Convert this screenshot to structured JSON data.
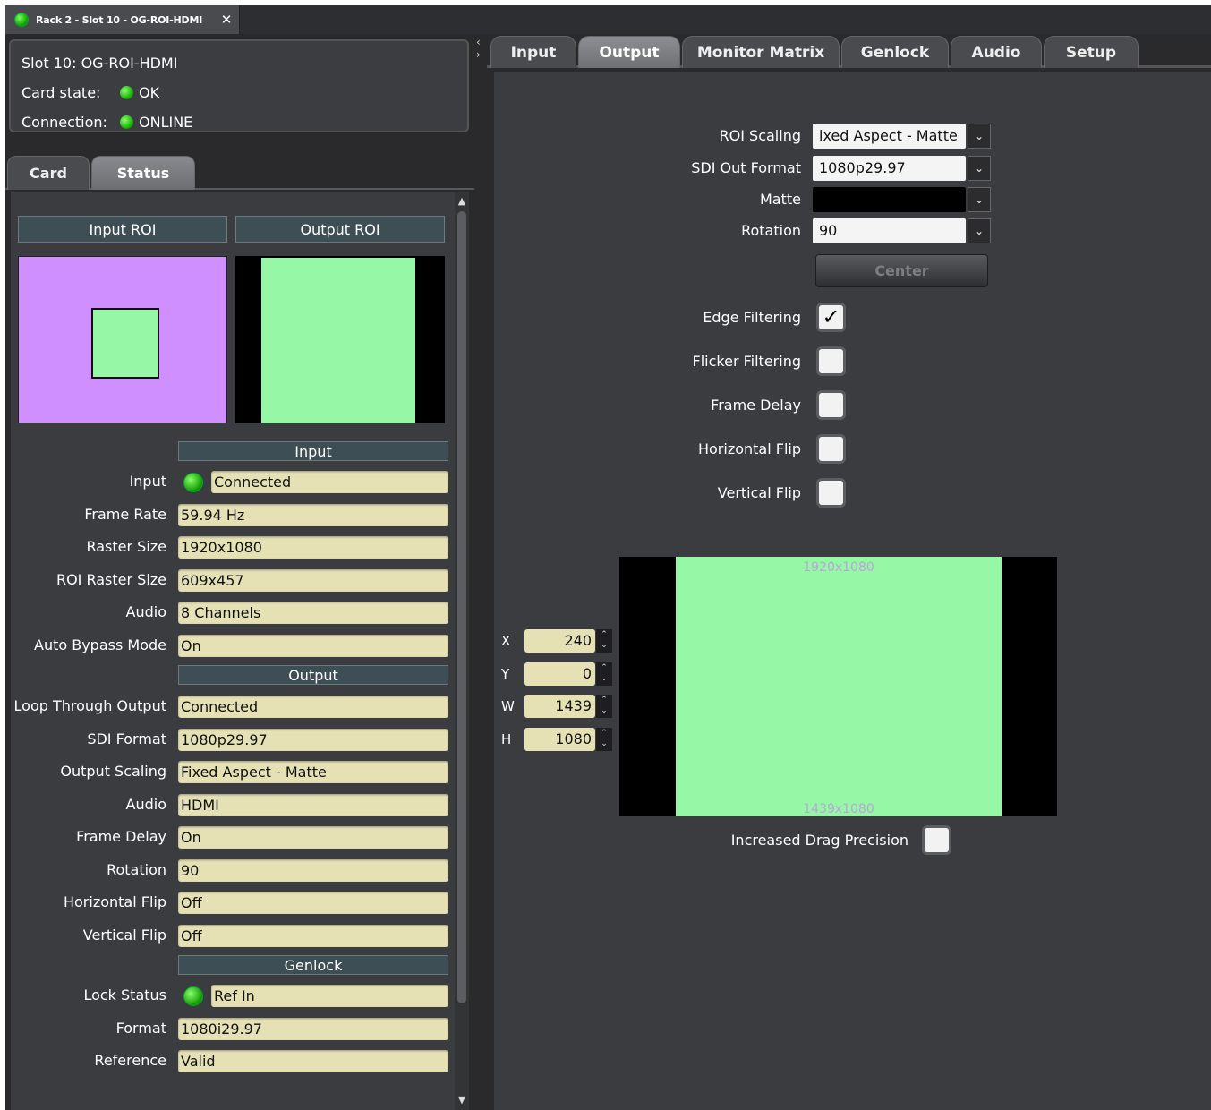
{
  "window": {
    "tab_title": "Rack 2 - Slot 10 - OG-ROI-HDMI",
    "close": "✕"
  },
  "card_info": {
    "slot": "Slot 10: OG-ROI-HDMI",
    "state_label": "Card state:",
    "state_value": "OK",
    "connection_label": "Connection:",
    "connection_value": "ONLINE"
  },
  "left_tabs": [
    "Card",
    "Status"
  ],
  "status": {
    "input_roi": "Input ROI",
    "output_roi": "Output ROI",
    "input_header": "Input",
    "input_rows": [
      {
        "label": "Input",
        "value": "Connected",
        "led": true
      },
      {
        "label": "Frame Rate",
        "value": "59.94 Hz"
      },
      {
        "label": "Raster Size",
        "value": "1920x1080"
      },
      {
        "label": "ROI Raster Size",
        "value": "609x457"
      },
      {
        "label": "Audio",
        "value": "8 Channels"
      },
      {
        "label": "Auto Bypass Mode",
        "value": "On"
      }
    ],
    "output_header": "Output",
    "output_rows": [
      {
        "label": "Loop Through Output",
        "value": "Connected"
      },
      {
        "label": "SDI Format",
        "value": "1080p29.97"
      },
      {
        "label": "Output Scaling",
        "value": "Fixed Aspect - Matte"
      },
      {
        "label": "Audio",
        "value": "HDMI"
      },
      {
        "label": "Frame Delay",
        "value": "On"
      },
      {
        "label": "Rotation",
        "value": "90"
      },
      {
        "label": "Horizontal Flip",
        "value": "Off"
      },
      {
        "label": "Vertical Flip",
        "value": "Off"
      }
    ],
    "genlock_header": "Genlock",
    "genlock_rows": [
      {
        "label": "Lock Status",
        "value": "Ref In",
        "led": true
      },
      {
        "label": "Format",
        "value": "1080i29.97"
      },
      {
        "label": "Reference",
        "value": "Valid"
      }
    ]
  },
  "right_tabs": [
    "Input",
    "Output",
    "Monitor Matrix",
    "Genlock",
    "Audio",
    "Setup"
  ],
  "output": {
    "roi_scaling_label": "ROI Scaling",
    "roi_scaling_value": "ixed Aspect - Matte",
    "sdi_out_label": "SDI Out Format",
    "sdi_out_value": "1080p29.97",
    "matte_label": "Matte",
    "rotation_label": "Rotation",
    "rotation_value": "90",
    "center_button": "Center",
    "checkboxes": [
      {
        "label": "Edge Filtering",
        "checked": true
      },
      {
        "label": "Flicker Filtering",
        "checked": false
      },
      {
        "label": "Frame Delay",
        "checked": false
      },
      {
        "label": "Horizontal Flip",
        "checked": false
      },
      {
        "label": "Vertical Flip",
        "checked": false
      }
    ],
    "geometry_fields": [
      {
        "label": "X",
        "value": "240"
      },
      {
        "label": "Y",
        "value": "0"
      },
      {
        "label": "W",
        "value": "1439"
      },
      {
        "label": "H",
        "value": "1080"
      }
    ],
    "preview_top_text": "1920x1080",
    "preview_bottom_text": "1439x1080",
    "drag_precision_label": "Increased Drag Precision",
    "check_mark": "✓"
  },
  "colors": {
    "led_green": "#10a800",
    "roi_purple": "#cf8fff",
    "roi_green": "#96f7a6",
    "value_field": "#e5e1b5"
  }
}
